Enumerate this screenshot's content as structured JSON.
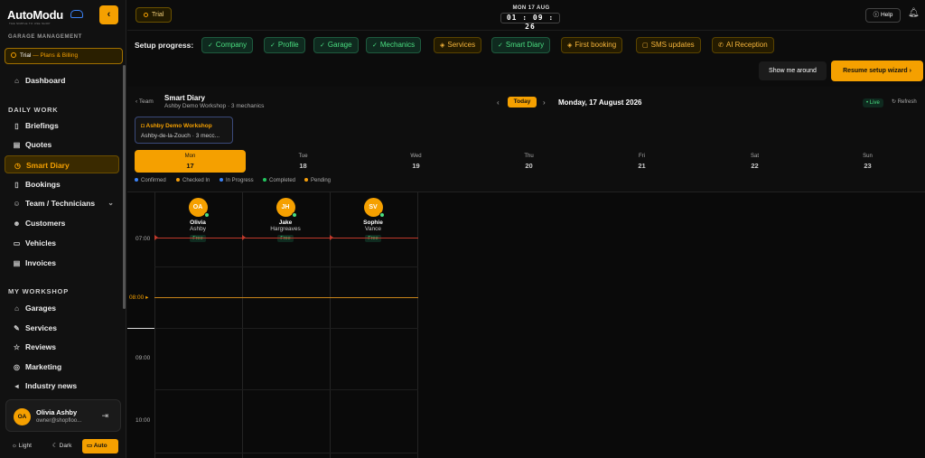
{
  "brand": {
    "name": "AutoModu",
    "tagline": "THE SIMPLE TO USE SHOP"
  },
  "sidebar": {
    "section_garage": "GARAGE MANAGEMENT",
    "trial": {
      "label": "Trial",
      "suffix": "— Plans & Billing"
    },
    "dashboard": "Dashboard",
    "section_daily": "DAILY WORK",
    "daily_items": [
      {
        "label": "Briefings",
        "icon": "book-icon"
      },
      {
        "label": "Quotes",
        "icon": "clipboard-icon"
      },
      {
        "label": "Smart Diary",
        "icon": "clock-icon",
        "active": true
      },
      {
        "label": "Bookings",
        "icon": "book-icon"
      },
      {
        "label": "Team / Technicians",
        "icon": "users-icon"
      },
      {
        "label": "Customers",
        "icon": "user-group-icon"
      },
      {
        "label": "Vehicles",
        "icon": "truck-icon"
      },
      {
        "label": "Invoices",
        "icon": "document-icon"
      }
    ],
    "section_workshop": "MY WORKSHOP",
    "workshop_items": [
      {
        "label": "Garages",
        "icon": "home-icon"
      },
      {
        "label": "Services",
        "icon": "wrench-icon"
      },
      {
        "label": "Reviews",
        "icon": "star-icon"
      },
      {
        "label": "Marketing",
        "icon": "target-icon"
      },
      {
        "label": "Industry news",
        "icon": "megaphone-icon"
      }
    ],
    "user": {
      "initials": "OA",
      "name": "Olivia Ashby",
      "email": "owner@shopfloo..."
    },
    "theme": {
      "light": "Light",
      "dark": "Dark",
      "auto": "Auto",
      "selected": "Auto"
    }
  },
  "topbar": {
    "trial_label": "Trial",
    "date": "MON 17 AUG",
    "time": "01 : 09 : 26",
    "help": "Help"
  },
  "setup": {
    "label": "Setup progress:",
    "steps": [
      {
        "label": "Company",
        "done": true
      },
      {
        "label": "Profile",
        "done": true
      },
      {
        "label": "Garage",
        "done": true
      },
      {
        "label": "Mechanics",
        "done": true
      },
      {
        "label": "Services",
        "done": false
      },
      {
        "label": "Smart Diary",
        "done": true
      },
      {
        "label": "First booking",
        "done": false
      },
      {
        "label": "SMS updates",
        "done": false
      },
      {
        "label": "AI Reception",
        "done": false
      }
    ],
    "show_me": "Show me around",
    "resume": "Resume setup wizard"
  },
  "diary": {
    "back": "Team",
    "title": "Smart Diary",
    "subtitle": "Ashby Demo Workshop · 3 mechanics",
    "today": "Today",
    "date": "Monday, 17 August 2026",
    "live": "Live",
    "refresh": "Refresh",
    "garage": {
      "name": "Ashby Demo Workshop",
      "sub": "Ashby-de-la-Zouch · 3 mecc..."
    },
    "days": [
      {
        "name": "Mon",
        "num": "17",
        "active": true
      },
      {
        "name": "Tue",
        "num": "18"
      },
      {
        "name": "Wed",
        "num": "19"
      },
      {
        "name": "Thu",
        "num": "20"
      },
      {
        "name": "Fri",
        "num": "21"
      },
      {
        "name": "Sat",
        "num": "22"
      },
      {
        "name": "Sun",
        "num": "23"
      }
    ],
    "legend": [
      {
        "label": "Confirmed",
        "color": "#3b82f6"
      },
      {
        "label": "Checked In",
        "color": "#f59e0b"
      },
      {
        "label": "In Progress",
        "color": "#3b82f6"
      },
      {
        "label": "Completed",
        "color": "#22c55e"
      },
      {
        "label": "Pending",
        "color": "#f59e0b"
      }
    ],
    "mechanics": [
      {
        "initials": "OA",
        "first": "Olivia",
        "last": "Ashby",
        "status": "Free"
      },
      {
        "initials": "JH",
        "first": "Jake",
        "last": "Hargreaves",
        "status": "Free"
      },
      {
        "initials": "SV",
        "first": "Sophie",
        "last": "Vance",
        "status": "Free"
      }
    ],
    "times": [
      "07:00",
      "08:00",
      "09:00",
      "10:00"
    ],
    "now_label": "08:00"
  },
  "colors": {
    "accent": "#f5a000",
    "success": "#4ade80",
    "now_line": "#c0392b"
  }
}
